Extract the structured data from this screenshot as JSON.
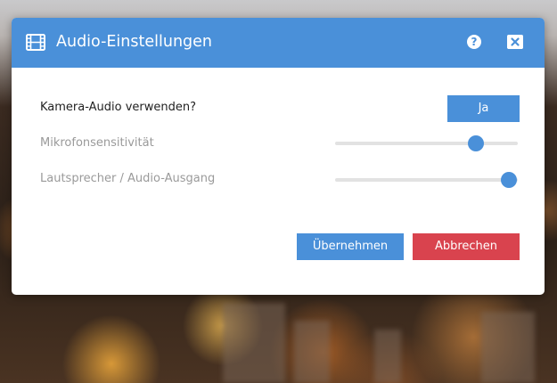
{
  "dialog": {
    "title": "Audio-Einstellungen",
    "header_icon": "film-icon",
    "help_icon": "question-circle-icon",
    "close_icon": "close-icon"
  },
  "settings": {
    "camera_audio": {
      "label": "Kamera-Audio verwenden?",
      "value": "Ja"
    },
    "mic_sensitivity": {
      "label": "Mikrofonsensitivität",
      "level": 0.77
    },
    "speaker_output": {
      "label": "Lautsprecher / Audio-Ausgang",
      "level": 0.95
    }
  },
  "actions": {
    "apply_label": "Übernehmen",
    "cancel_label": "Abbrechen"
  },
  "colors": {
    "accent": "#4a90d9",
    "danger": "#d9434e"
  }
}
